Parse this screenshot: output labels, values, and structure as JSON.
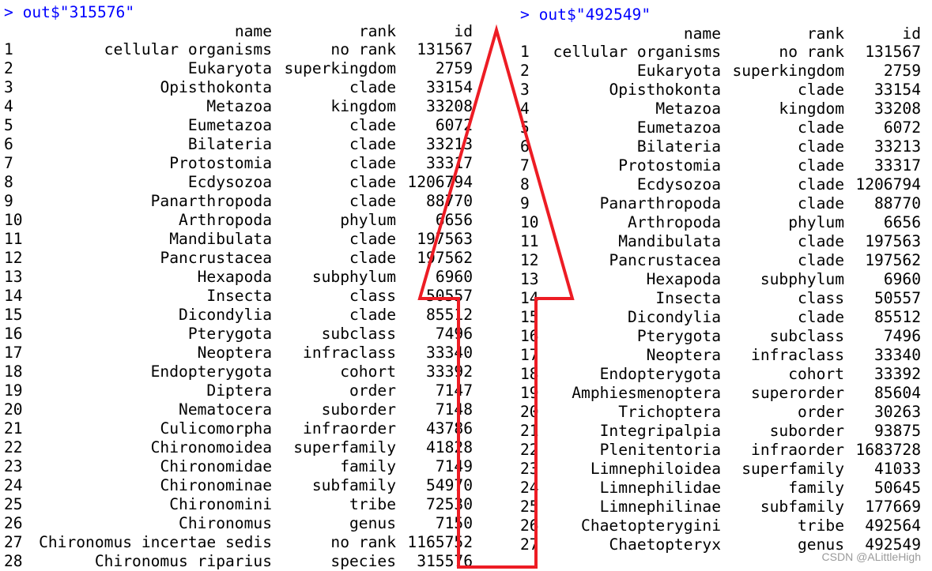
{
  "left": {
    "command": "> out$\"315576\"",
    "headers": {
      "name": "name",
      "rank": "rank",
      "id": "id"
    },
    "rows": [
      [
        "1",
        "cellular organisms",
        "no rank",
        "131567"
      ],
      [
        "2",
        "Eukaryota",
        "superkingdom",
        "2759"
      ],
      [
        "3",
        "Opisthokonta",
        "clade",
        "33154"
      ],
      [
        "4",
        "Metazoa",
        "kingdom",
        "33208"
      ],
      [
        "5",
        "Eumetazoa",
        "clade",
        "6072"
      ],
      [
        "6",
        "Bilateria",
        "clade",
        "33213"
      ],
      [
        "7",
        "Protostomia",
        "clade",
        "33317"
      ],
      [
        "8",
        "Ecdysozoa",
        "clade",
        "1206794"
      ],
      [
        "9",
        "Panarthropoda",
        "clade",
        "88770"
      ],
      [
        "10",
        "Arthropoda",
        "phylum",
        "6656"
      ],
      [
        "11",
        "Mandibulata",
        "clade",
        "197563"
      ],
      [
        "12",
        "Pancrustacea",
        "clade",
        "197562"
      ],
      [
        "13",
        "Hexapoda",
        "subphylum",
        "6960"
      ],
      [
        "14",
        "Insecta",
        "class",
        "50557"
      ],
      [
        "15",
        "Dicondylia",
        "clade",
        "85512"
      ],
      [
        "16",
        "Pterygota",
        "subclass",
        "7496"
      ],
      [
        "17",
        "Neoptera",
        "infraclass",
        "33340"
      ],
      [
        "18",
        "Endopterygota",
        "cohort",
        "33392"
      ],
      [
        "19",
        "Diptera",
        "order",
        "7147"
      ],
      [
        "20",
        "Nematocera",
        "suborder",
        "7148"
      ],
      [
        "21",
        "Culicomorpha",
        "infraorder",
        "43786"
      ],
      [
        "22",
        "Chironomoidea",
        "superfamily",
        "41828"
      ],
      [
        "23",
        "Chironomidae",
        "family",
        "7149"
      ],
      [
        "24",
        "Chironominae",
        "subfamily",
        "54970"
      ],
      [
        "25",
        "Chironomini",
        "tribe",
        "72530"
      ],
      [
        "26",
        "Chironomus",
        "genus",
        "7150"
      ],
      [
        "27",
        "Chironomus incertae sedis",
        "no rank",
        "1165752"
      ],
      [
        "28",
        "Chironomus riparius",
        "species",
        "315576"
      ]
    ]
  },
  "right": {
    "command": "> out$\"492549\"",
    "headers": {
      "name": "name",
      "rank": "rank",
      "id": "id"
    },
    "rows": [
      [
        "1",
        "cellular organisms",
        "no rank",
        "131567"
      ],
      [
        "2",
        "Eukaryota",
        "superkingdom",
        "2759"
      ],
      [
        "3",
        "Opisthokonta",
        "clade",
        "33154"
      ],
      [
        "4",
        "Metazoa",
        "kingdom",
        "33208"
      ],
      [
        "5",
        "Eumetazoa",
        "clade",
        "6072"
      ],
      [
        "6",
        "Bilateria",
        "clade",
        "33213"
      ],
      [
        "7",
        "Protostomia",
        "clade",
        "33317"
      ],
      [
        "8",
        "Ecdysozoa",
        "clade",
        "1206794"
      ],
      [
        "9",
        "Panarthropoda",
        "clade",
        "88770"
      ],
      [
        "10",
        "Arthropoda",
        "phylum",
        "6656"
      ],
      [
        "11",
        "Mandibulata",
        "clade",
        "197563"
      ],
      [
        "12",
        "Pancrustacea",
        "clade",
        "197562"
      ],
      [
        "13",
        "Hexapoda",
        "subphylum",
        "6960"
      ],
      [
        "14",
        "Insecta",
        "class",
        "50557"
      ],
      [
        "15",
        "Dicondylia",
        "clade",
        "85512"
      ],
      [
        "16",
        "Pterygota",
        "subclass",
        "7496"
      ],
      [
        "17",
        "Neoptera",
        "infraclass",
        "33340"
      ],
      [
        "18",
        "Endopterygota",
        "cohort",
        "33392"
      ],
      [
        "19",
        "Amphiesmenoptera",
        "superorder",
        "85604"
      ],
      [
        "20",
        "Trichoptera",
        "order",
        "30263"
      ],
      [
        "21",
        "Integripalpia",
        "suborder",
        "93875"
      ],
      [
        "22",
        "Plenitentoria",
        "infraorder",
        "1683728"
      ],
      [
        "23",
        "Limnephiloidea",
        "superfamily",
        "41033"
      ],
      [
        "24",
        "Limnephilidae",
        "family",
        "50645"
      ],
      [
        "25",
        "Limnephilinae",
        "subfamily",
        "177669"
      ],
      [
        "26",
        "Chaetopterygini",
        "tribe",
        "492564"
      ],
      [
        "27",
        "Chaetopteryx",
        "genus",
        "492549"
      ]
    ]
  },
  "annotation": {
    "arrow_color": "#ed1c24",
    "arrow_direction": "up"
  },
  "watermark": "CSDN @ALittleHigh",
  "colors": {
    "command": "#0000ff",
    "text": "#000000"
  }
}
